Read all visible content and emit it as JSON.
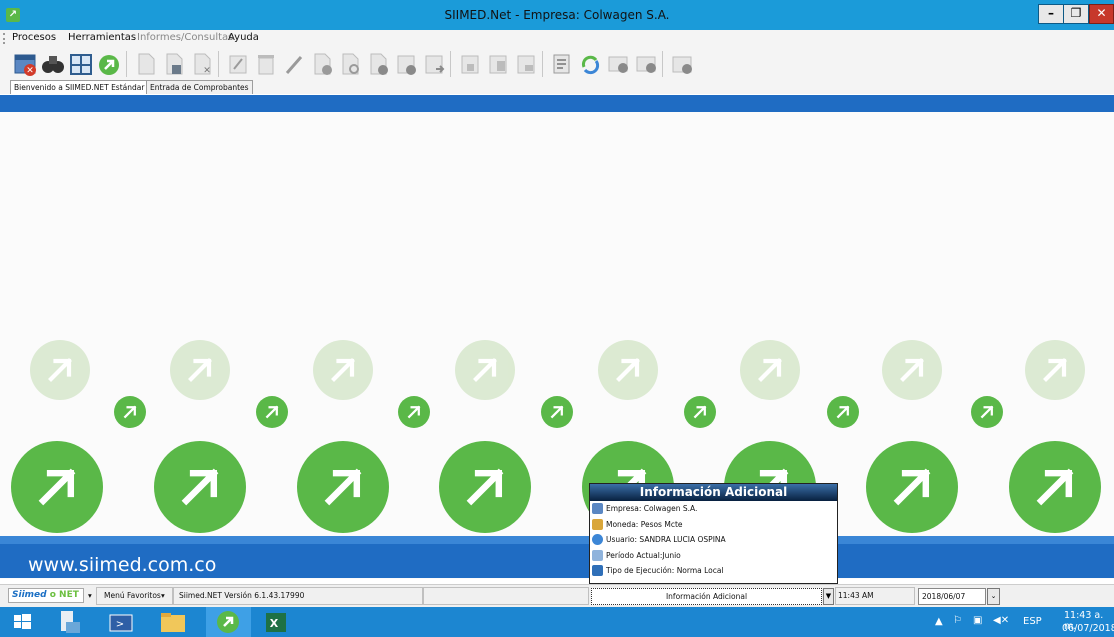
{
  "window": {
    "title": "SIIMED.Net -  Empresa: Colwagen S.A.",
    "minimize_label": "–",
    "maximize_label": "❐",
    "close_label": "✕"
  },
  "menu": [
    {
      "label": "Procesos",
      "enabled": true
    },
    {
      "label": "Herramientas",
      "enabled": true
    },
    {
      "label": "Informes/Consultas",
      "enabled": false
    },
    {
      "label": "Ayuda",
      "enabled": true
    }
  ],
  "toolbar": {
    "icons": [
      "calendar-close-icon",
      "binoculars-icon",
      "grid-icon",
      "go-icon",
      "new-page-icon",
      "save-icon",
      "cancel-icon",
      "edit-icon",
      "delete-icon",
      "pencil-icon",
      "remove-record-icon",
      "settings-record-icon",
      "disabled-record-icon",
      "approve-icon",
      "export-icon",
      "print-icon",
      "copy-icon",
      "print-preview-icon",
      "list-icon",
      "refresh-icon",
      "minus-icon",
      "plus-icon",
      "close-doc-icon"
    ],
    "more_label": "▾"
  },
  "tabs": [
    {
      "label": "Bienvenido a SIIMED.NET Estándar",
      "active": true
    },
    {
      "label": "Entrada de Comprobantes",
      "active": false
    }
  ],
  "main": {
    "website": "www.siimed.com.co"
  },
  "info_panel": {
    "title": "Información Adicional",
    "rows": [
      {
        "label": "Empresa: Colwagen S.A.",
        "icon": "company-icon"
      },
      {
        "label": "Moneda: Pesos Mcte",
        "icon": "currency-icon"
      },
      {
        "label": "Usuario: SANDRA LUCIA OSPINA",
        "icon": "user-icon"
      },
      {
        "label": "Período Actual:Junio",
        "icon": "calendar-icon"
      },
      {
        "label": "Tipo de Ejecución: Norma Local",
        "icon": "execution-type-icon"
      }
    ]
  },
  "statusbar": {
    "logo_a": "Siimed",
    "logo_b": "o NET",
    "favorites_label": "Menú Favoritos",
    "version": "Siimed.NET Versión 6.1.43.17990",
    "combo_value": "Información Adicional",
    "time": "11:43 AM",
    "date": "2018/06/07"
  },
  "taskbar": {
    "apps": [
      "windows-start-icon",
      "file-server-icon",
      "powershell-icon",
      "file-explorer-icon",
      "siimed-app-icon",
      "excel-icon"
    ],
    "lang": "ESP",
    "clock_time": "11:43 a. m.",
    "clock_date": "06/07/2018"
  },
  "colors": {
    "titlebar": "#1b9bd9",
    "accent_blue": "#1f6cc3",
    "brand_green": "#5ab848",
    "taskbar": "#1c86d1"
  }
}
